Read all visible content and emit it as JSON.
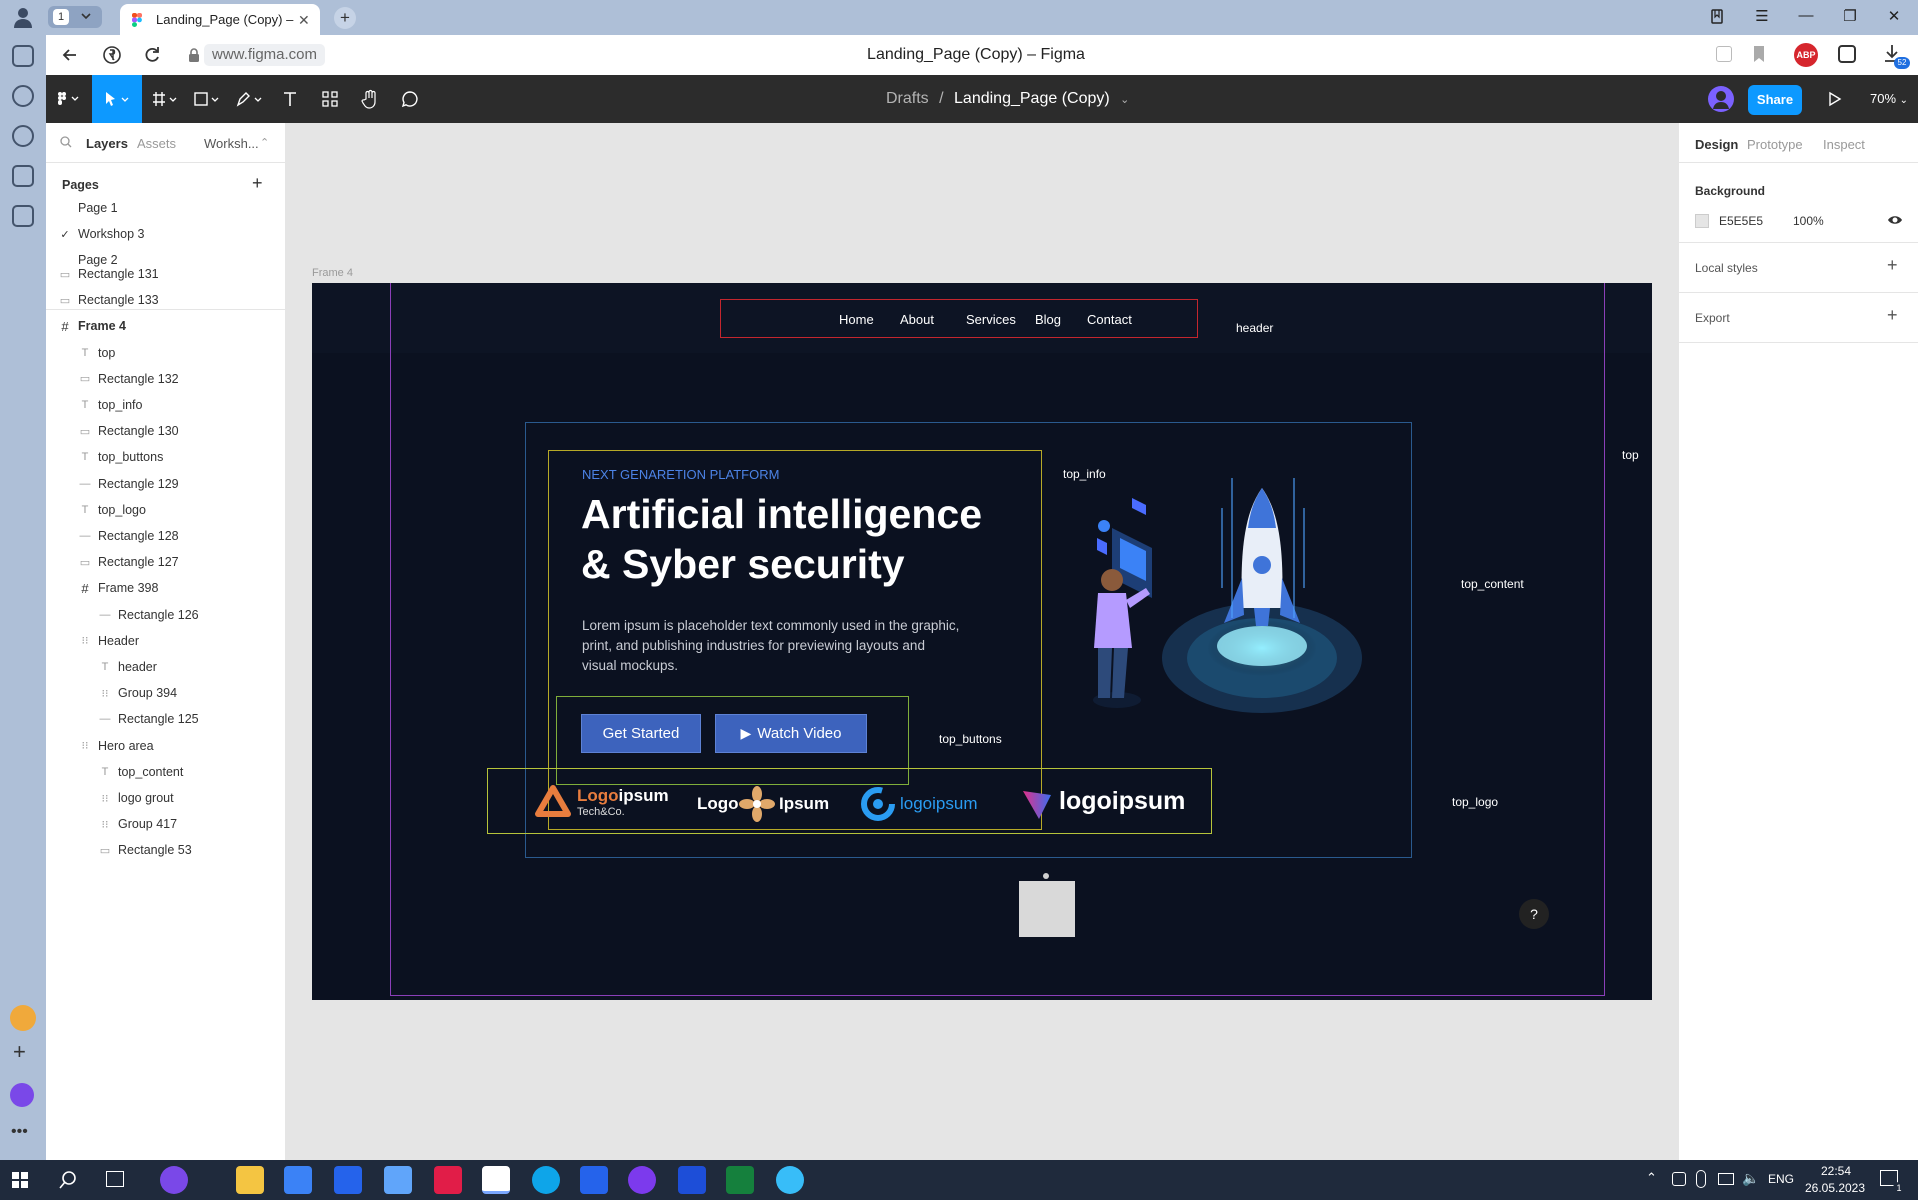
{
  "browser": {
    "tab_count": "1",
    "tab_title": "Landing_Page (Copy) – F",
    "url": "www.figma.com",
    "page_title": "Landing_Page (Copy) – Figma",
    "abp_label": "ABP",
    "download_badge": "52"
  },
  "toolbar": {
    "breadcrumb_root": "Drafts",
    "breadcrumb_sep": "/",
    "file_name": "Landing_Page (Copy)",
    "share_label": "Share",
    "zoom": "70%"
  },
  "left_panel": {
    "tabs": [
      "Layers",
      "Assets",
      "Worksh..."
    ],
    "pages_title": "Pages",
    "pages": [
      {
        "label": "Page 1",
        "checked": false
      },
      {
        "label": "Workshop 3",
        "checked": true
      },
      {
        "label": "Page 2",
        "checked": false
      }
    ],
    "layers": [
      {
        "label": "Rectangle 131",
        "icon": "rect-icon"
      },
      {
        "label": "Rectangle 133",
        "icon": "rect-icon"
      },
      {
        "label": "Frame 4",
        "icon": "frame-icon"
      },
      {
        "label": "top",
        "icon": "text-icon"
      },
      {
        "label": "Rectangle 132",
        "icon": "rect-icon"
      },
      {
        "label": "top_info",
        "icon": "text-icon"
      },
      {
        "label": "Rectangle 130",
        "icon": "rect-icon"
      },
      {
        "label": "top_buttons",
        "icon": "text-icon"
      },
      {
        "label": "Rectangle 129",
        "icon": "line-icon"
      },
      {
        "label": "top_logo",
        "icon": "text-icon"
      },
      {
        "label": "Rectangle 128",
        "icon": "line-icon"
      },
      {
        "label": "Rectangle 127",
        "icon": "rect-icon"
      },
      {
        "label": "Frame 398",
        "icon": "frame-icon"
      },
      {
        "label": "Rectangle 126",
        "icon": "line-icon"
      },
      {
        "label": "Header",
        "icon": "group-icon"
      },
      {
        "label": "header",
        "icon": "text-icon"
      },
      {
        "label": "Group 394",
        "icon": "group-icon"
      },
      {
        "label": "Rectangle 125",
        "icon": "line-icon"
      },
      {
        "label": "Hero area",
        "icon": "group-icon"
      },
      {
        "label": "top_content",
        "icon": "text-icon"
      },
      {
        "label": "logo grout",
        "icon": "group-icon"
      },
      {
        "label": "Group 417",
        "icon": "group-icon"
      },
      {
        "label": "Rectangle 53",
        "icon": "rect-icon"
      }
    ]
  },
  "right_panel": {
    "tabs": [
      "Design",
      "Prototype",
      "Inspect"
    ],
    "background_title": "Background",
    "bg_hex": "E5E5E5",
    "bg_opacity": "100%",
    "local_styles": "Local styles",
    "export": "Export"
  },
  "canvas": {
    "frame_label": "Frame 4",
    "nav": [
      "Home",
      "About",
      "Services",
      "Blog",
      "Contact"
    ],
    "labels": {
      "header": "header",
      "top": "top",
      "top_info": "top_info",
      "top_content": "top_content",
      "top_buttons": "top_buttons",
      "top_logo": "top_logo"
    },
    "hero": {
      "eyebrow": "NEXT GENARETION PLATFORM",
      "headline_1": "Artificial intelligence",
      "headline_2": "& Syber security",
      "body_1": "Lorem ipsum is placeholder text commonly used in the graphic,",
      "body_2": "print, and publishing industries for previewing layouts and",
      "body_3": "visual mockups.",
      "primary_button": "Get Started",
      "secondary_button": "Watch Video"
    },
    "logos": [
      {
        "word_a": "Logo",
        "word_b": "ipsum",
        "sub": "Tech&Co."
      },
      {
        "word_a": "Logo",
        "word_b": "Ipsum"
      },
      {
        "word_a": "logo",
        "word_b": "ipsum"
      },
      {
        "word_a": "logoipsum"
      }
    ]
  },
  "taskbar": {
    "language": "ENG",
    "time": "22:54",
    "date": "26.05.2023",
    "notification_count": "1"
  },
  "colors": {
    "figma_blue": "#0d99ff",
    "frame_bg": "#0b1120",
    "button_blue": "#3d63bd",
    "eyebrow_blue": "#4c83e6"
  }
}
